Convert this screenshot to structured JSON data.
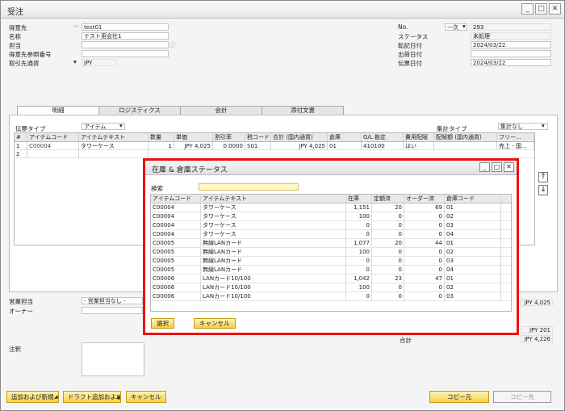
{
  "window": {
    "title": "受注"
  },
  "header_left": {
    "customer_label": "得意先",
    "customer_value": "test01",
    "name_label": "名称",
    "name_value": "テスト用会社1",
    "contact_label": "担当",
    "ref_label": "得意先参照番号",
    "currency_label": "取引先通貨",
    "currency_value": "JPY"
  },
  "header_right": {
    "no_label": "No.",
    "series_value": "一次",
    "no_value": "293",
    "status_label": "ステータス",
    "status_value": "未処理",
    "posting_label": "転記日付",
    "posting_value": "2024/03/22",
    "delivery_label": "出荷日付",
    "doc_date_label": "伝票日付",
    "doc_date_value": "2024/03/22"
  },
  "tabs": [
    "明細",
    "ロジスティクス",
    "会計",
    "添付文書"
  ],
  "lines": {
    "item_type_label": "伝票タイプ",
    "item_type_value": "アイテム",
    "summary_label": "集計タイプ",
    "summary_value": "集計なし",
    "columns": [
      "#",
      "アイテムコード",
      "アイテムテキスト",
      "数量",
      "単価",
      "割引率",
      "税コード",
      "合計 (国内通貨)",
      "倉庫",
      "G/L 勘定",
      "費用配賦",
      "配賦額 (国内通貨)",
      "フリー..."
    ],
    "rows": [
      [
        "1",
        "C00004",
        "タワーケース",
        "1",
        "JPY 4,025",
        "0.0000",
        "S01",
        "JPY 4,025",
        "01",
        "410100",
        "はい",
        "",
        "売上 - 国..."
      ],
      [
        "2",
        "",
        "",
        "",
        "",
        "",
        "",
        "",
        "",
        "",
        "",
        "",
        ""
      ]
    ]
  },
  "footer": {
    "sales_rep_label": "営業担当",
    "sales_rep_value": "- 営業担当なし -",
    "owner_label": "オーナー",
    "remarks_label": "注釈",
    "total_label": "合計",
    "amount1": "JPY 4,025",
    "amount2": "JPY 201",
    "amount3": "JPY 4,226"
  },
  "buttons": {
    "add_new": "追加および新規",
    "draft": "ドラフト追加および...",
    "cancel": "キャンセル",
    "copy_from": "コピー元",
    "copy_to": "コピー先"
  },
  "modal": {
    "title": "在庫 & 倉庫ステータス",
    "search_label": "検索",
    "columns": [
      "アイテムコード",
      "アイテムテキスト",
      "在庫",
      "定額済",
      "オーダー済",
      "倉庫コード"
    ],
    "rows": [
      [
        "C00004",
        "タワーケース",
        "1,151",
        "20",
        "69",
        "01"
      ],
      [
        "C00004",
        "タワーケース",
        "100",
        "0",
        "0",
        "02"
      ],
      [
        "C00004",
        "タワーケース",
        "0",
        "0",
        "0",
        "03"
      ],
      [
        "C00004",
        "タワーケース",
        "0",
        "0",
        "0",
        "04"
      ],
      [
        "C00005",
        "無線LANカード",
        "1,077",
        "20",
        "44",
        "01"
      ],
      [
        "C00005",
        "無線LANカード",
        "100",
        "0",
        "0",
        "02"
      ],
      [
        "C00005",
        "無線LANカード",
        "0",
        "0",
        "0",
        "03"
      ],
      [
        "C00005",
        "無線LANカード",
        "0",
        "0",
        "0",
        "04"
      ],
      [
        "C00006",
        "LANカード10/100",
        "1,042",
        "23",
        "47",
        "01"
      ],
      [
        "C00006",
        "LANカード10/100",
        "100",
        "0",
        "0",
        "02"
      ],
      [
        "C00006",
        "LANカード10/100",
        "0",
        "0",
        "0",
        "03"
      ]
    ],
    "select_button": "選択",
    "cancel_button": "キャンセル"
  }
}
